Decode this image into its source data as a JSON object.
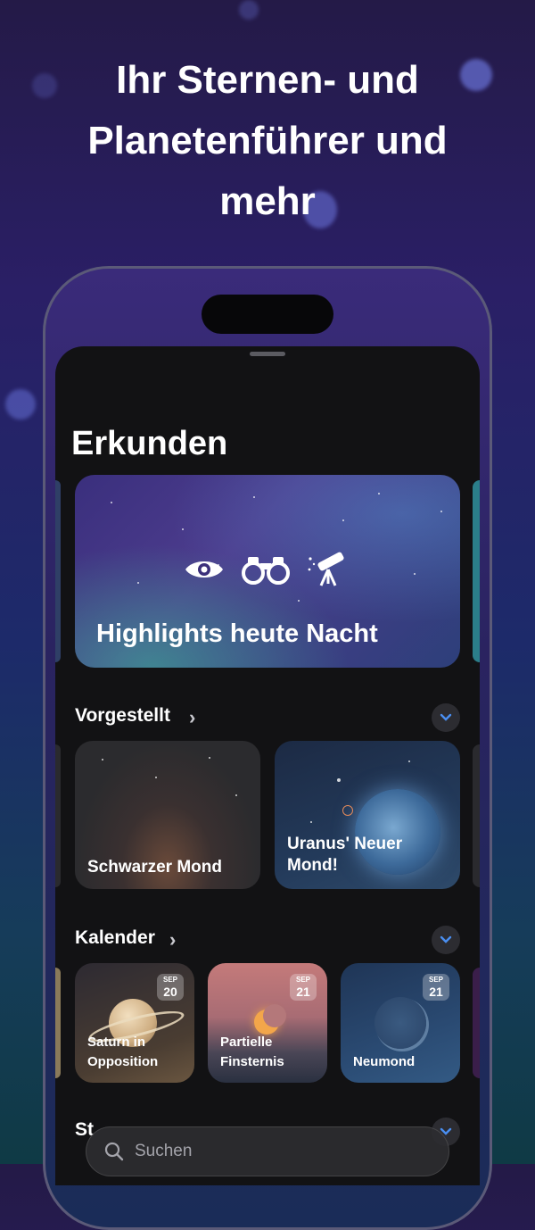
{
  "headline": "Ihr Sternen- und Planetenführer und mehr",
  "app": {
    "page_title": "Erkunden",
    "hero": {
      "label": "Highlights heute Nacht",
      "icons": [
        "eye-icon",
        "binoculars-icon",
        "telescope-icon"
      ]
    },
    "sections": {
      "featured": {
        "title": "Vorgestellt",
        "cards": [
          {
            "label": "Schwarzer Mond"
          },
          {
            "label": "Uranus' Neuer Mond!"
          }
        ]
      },
      "calendar": {
        "title": "Kalender",
        "events": [
          {
            "month": "SEP",
            "day": "20",
            "label": "Saturn in Opposition"
          },
          {
            "month": "SEP",
            "day": "21",
            "label": "Partielle Finsternis"
          },
          {
            "month": "SEP",
            "day": "21",
            "label": "Neumond"
          }
        ]
      },
      "next": {
        "title": "St"
      }
    },
    "search": {
      "placeholder": "Suchen"
    }
  },
  "colors": {
    "background_top": "#241a47",
    "sheet": "#121214",
    "accent_blue": "#4a8ef0"
  }
}
